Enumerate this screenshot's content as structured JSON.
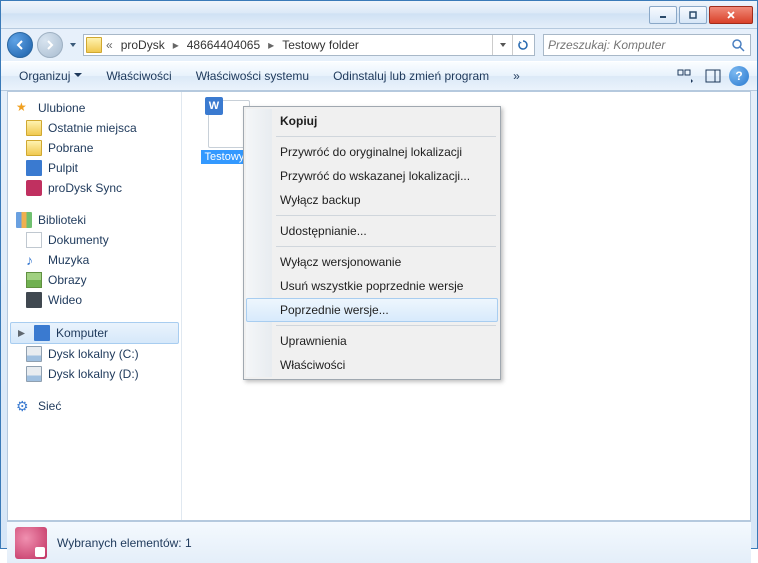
{
  "breadcrumb": {
    "segments": [
      "proDysk",
      "48664404065",
      "Testowy folder"
    ]
  },
  "search": {
    "placeholder": "Przeszukaj: Komputer"
  },
  "toolbar": {
    "organize": "Organizuj",
    "properties": "Właściwości",
    "system_properties": "Właściwości systemu",
    "uninstall": "Odinstaluj lub zmień program",
    "overflow": "»"
  },
  "sidebar": {
    "favorites": {
      "label": "Ulubione",
      "items": [
        "Ostatnie miejsca",
        "Pobrane",
        "Pulpit",
        "proDysk Sync"
      ]
    },
    "libraries": {
      "label": "Biblioteki",
      "items": [
        "Dokumenty",
        "Muzyka",
        "Obrazy",
        "Wideo"
      ]
    },
    "computer": {
      "label": "Komputer",
      "items": [
        "Dysk lokalny (C:)",
        "Dysk lokalny (D:)"
      ]
    },
    "network": {
      "label": "Sieć"
    }
  },
  "content": {
    "file_label": "Testowy p"
  },
  "context_menu": {
    "copy": "Kopiuj",
    "restore_original": "Przywróć do oryginalnej lokalizacji",
    "restore_selected": "Przywróć do wskazanej lokalizacji...",
    "disable_backup": "Wyłącz backup",
    "sharing": "Udostępnianie...",
    "disable_versioning": "Wyłącz wersjonowanie",
    "delete_versions": "Usuń wszystkie poprzednie wersje",
    "previous_versions": "Poprzednie wersje...",
    "permissions": "Uprawnienia",
    "properties": "Właściwości"
  },
  "statusbar": {
    "text": "Wybranych elementów: 1"
  }
}
